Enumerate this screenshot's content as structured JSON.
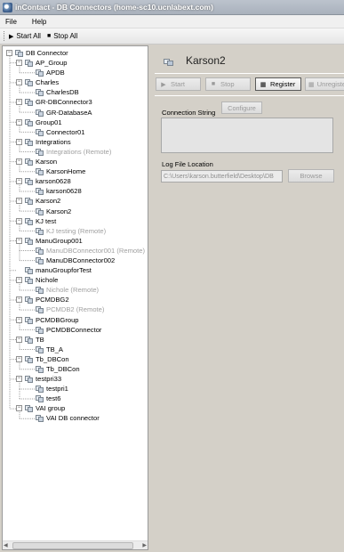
{
  "window": {
    "title": "inContact - DB Connectors (home-sc10.ucnlabext.com)"
  },
  "menu": {
    "file": "File",
    "help": "Help"
  },
  "toolbar": {
    "start_all": "Start All",
    "stop_all": "Stop All"
  },
  "tree": {
    "root": "DB Connector",
    "groups": [
      {
        "label": "AP_Group",
        "children": [
          {
            "label": "APDB",
            "remote": false
          }
        ]
      },
      {
        "label": "Charles",
        "children": [
          {
            "label": "CharlesDB",
            "remote": false
          }
        ]
      },
      {
        "label": "GR-DBConnector3",
        "children": [
          {
            "label": "GR-DatabaseA",
            "remote": false
          }
        ]
      },
      {
        "label": "Group01",
        "children": [
          {
            "label": "Connector01",
            "remote": false
          }
        ]
      },
      {
        "label": "Integrations",
        "children": [
          {
            "label": "Integrations (Remote)",
            "remote": true
          }
        ]
      },
      {
        "label": "Karson",
        "children": [
          {
            "label": "KarsonHome",
            "remote": false
          }
        ]
      },
      {
        "label": "karson0628",
        "children": [
          {
            "label": "karson0628",
            "remote": false
          }
        ]
      },
      {
        "label": "Karson2",
        "children": [
          {
            "label": "Karson2",
            "remote": false
          }
        ]
      },
      {
        "label": "KJ test",
        "children": [
          {
            "label": "KJ testing (Remote)",
            "remote": true
          }
        ]
      },
      {
        "label": "ManuGroup001",
        "children": [
          {
            "label": "ManuDBConnector001 (Remote)",
            "remote": true
          },
          {
            "label": "ManuDBConnector002",
            "remote": false
          }
        ]
      },
      {
        "label": "manuGroupforTest",
        "children": []
      },
      {
        "label": "Nichole",
        "children": [
          {
            "label": "Nichole (Remote)",
            "remote": true
          }
        ]
      },
      {
        "label": "PCMDBG2",
        "children": [
          {
            "label": "PCMDB2 (Remote)",
            "remote": true
          }
        ]
      },
      {
        "label": "PCMDBGroup",
        "children": [
          {
            "label": "PCMDBConnector",
            "remote": false
          }
        ]
      },
      {
        "label": "TB",
        "children": [
          {
            "label": "TB_A",
            "remote": false
          }
        ]
      },
      {
        "label": "Tb_DBCon",
        "children": [
          {
            "label": "Tb_DBCon",
            "remote": false
          }
        ]
      },
      {
        "label": "testpri33",
        "children": [
          {
            "label": "testpri1",
            "remote": false
          },
          {
            "label": "test6",
            "remote": false
          }
        ]
      },
      {
        "label": "VAI group",
        "children": [
          {
            "label": "VAI DB connector",
            "remote": false
          }
        ]
      }
    ]
  },
  "detail": {
    "title": "Karson2",
    "buttons": {
      "start": "Start",
      "stop": "Stop",
      "register": "Register",
      "unregister": "Unregister"
    },
    "connection_string_label": "Connection String",
    "configure_label": "Configure",
    "connection_string_value": "",
    "log_file_label": "Log File Location",
    "log_file_value": "C:\\Users\\karson.butterfield\\Desktop\\DB",
    "browse_label": "Browse"
  }
}
